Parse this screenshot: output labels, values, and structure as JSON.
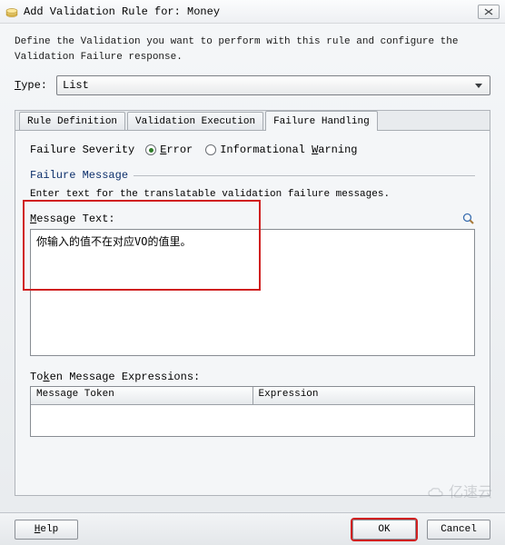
{
  "title": "Add Validation Rule for: Money",
  "description": "Define the Validation you want to perform with this rule and configure the Validation Failure response.",
  "typeLabel": "Type:",
  "typeValue": "List",
  "tabs": {
    "t1": "Rule Definition",
    "t2": "Validation Execution",
    "t3": "Failure Handling"
  },
  "severity": {
    "label": "Failure Severity",
    "error": "Error",
    "warn": "Informational Warning"
  },
  "failureMsg": {
    "title": "Failure Message",
    "desc": "Enter text for the translatable validation failure messages.",
    "msgLabel": "Message Text:",
    "msgValue": "你输入的值不在对应VO的值里。",
    "tokLabel": "Token Message Expressions:",
    "col1": "Message Token",
    "col2": "Expression"
  },
  "buttons": {
    "help": "Help",
    "ok": "OK",
    "cancel": "Cancel"
  },
  "watermark": "亿速云"
}
